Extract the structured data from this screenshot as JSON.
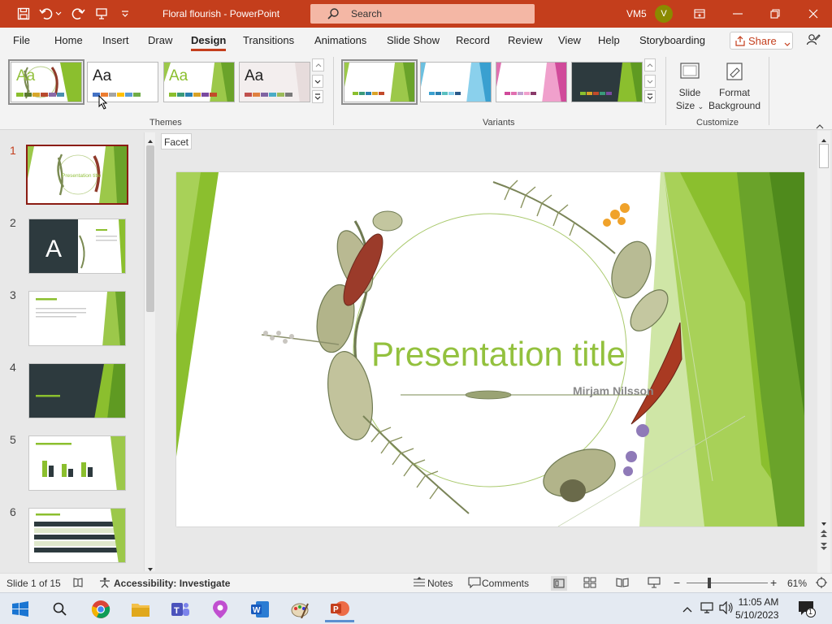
{
  "titlebar": {
    "doc_title": "Floral flourish - PowerPoint",
    "search_placeholder": "Search",
    "user_name": "VM5",
    "avatar_initial": "V"
  },
  "tabs": [
    "File",
    "Home",
    "Insert",
    "Draw",
    "Design",
    "Transitions",
    "Animations",
    "Slide Show",
    "Record",
    "Review",
    "View",
    "Help",
    "Storyboarding"
  ],
  "active_tab": "Design",
  "share_label": "Share",
  "ribbon": {
    "themes_label": "Themes",
    "variants_label": "Variants",
    "customize_label": "Customize",
    "theme_sample": "Aa",
    "slide_size": "Slide",
    "slide_size_2": "Size",
    "format_background": "Format",
    "format_background_2": "Background"
  },
  "tooltip": "Facet",
  "slides": {
    "numbers": [
      "1",
      "2",
      "3",
      "4",
      "5",
      "6"
    ],
    "current": "1"
  },
  "slide": {
    "title": "Presentation title",
    "subtitle": "Mirjam Nilsson"
  },
  "status": {
    "slide_count": "Slide 1 of 15",
    "accessibility": "Accessibility: Investigate",
    "notes": "Notes",
    "comments": "Comments",
    "zoom": "61%"
  },
  "taskbar": {
    "time": "11:05 AM",
    "date": "5/10/2023",
    "notification_count": "1"
  },
  "colors": {
    "accent": "#c43e1c",
    "slide_green": "#8bbf2e",
    "title_green": "#93c13e"
  }
}
